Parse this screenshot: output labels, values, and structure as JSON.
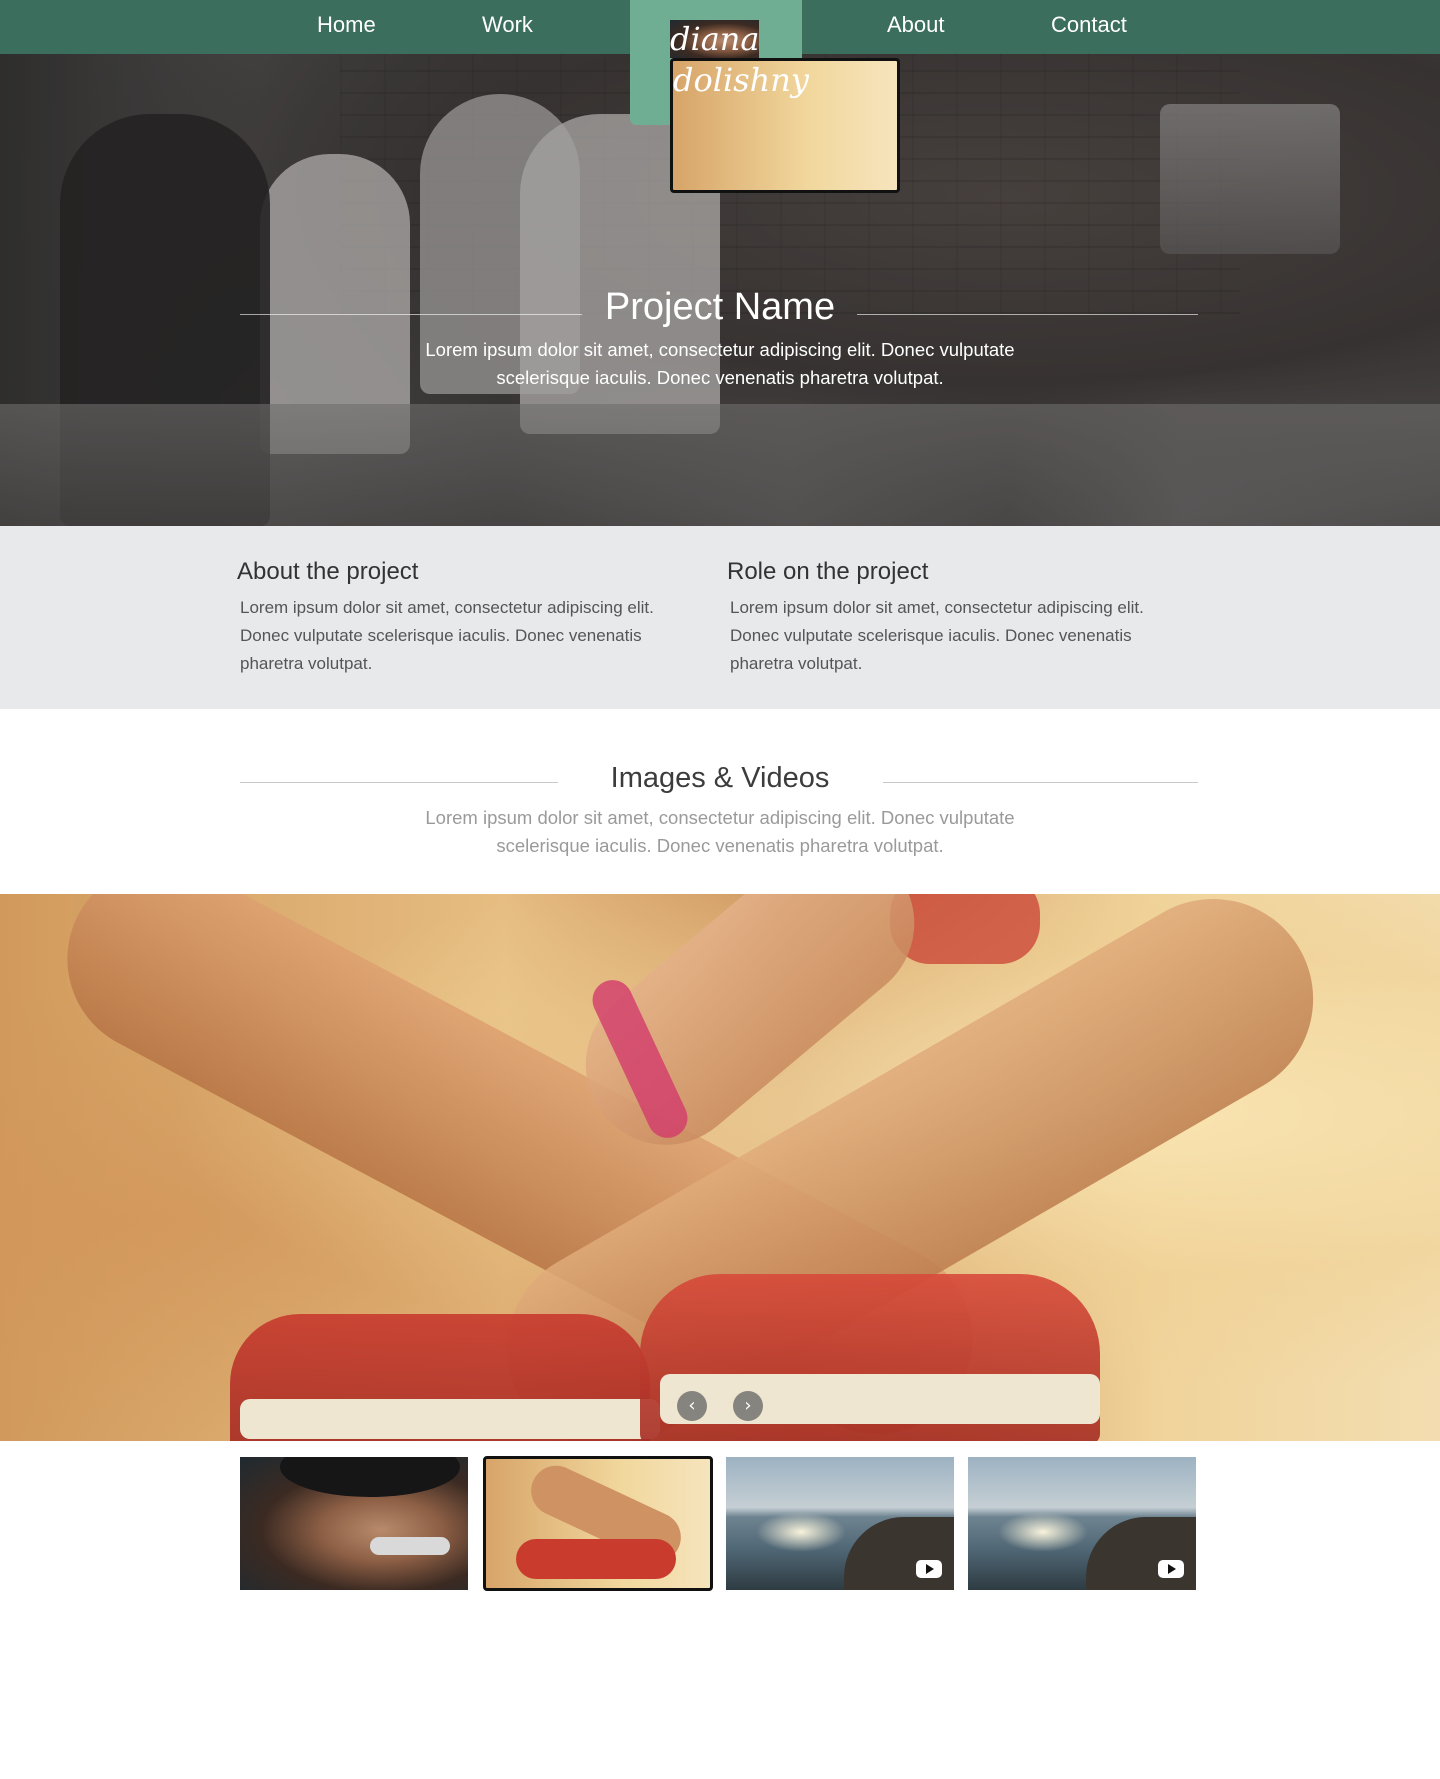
{
  "nav": {
    "items": [
      {
        "label": "Home"
      },
      {
        "label": "Work"
      },
      {
        "label": "About"
      },
      {
        "label": "Contact"
      }
    ],
    "logo": {
      "line1": "diana",
      "line2": "dolishny"
    },
    "bg_color": "#3b6e5c",
    "logo_color": "#6fae93"
  },
  "hero": {
    "title": "Project Name",
    "subtitle": "Lorem ipsum dolor sit amet, consectetur adipiscing elit. Donec vulputate scelerisque iaculis. Donec venenatis pharetra volutpat."
  },
  "about": {
    "project_title": "About the project",
    "project_text": "Lorem ipsum dolor sit amet, consectetur adipiscing elit. Donec vulputate scelerisque iaculis. Donec venenatis pharetra volutpat.",
    "role_title": "Role on the project",
    "role_text": "Lorem ipsum dolor sit amet, consectetur adipiscing elit. Donec vulputate scelerisque iaculis. Donec venenatis pharetra volutpat."
  },
  "media": {
    "title": "Images & Videos",
    "subtitle": "Lorem ipsum dolor sit amet, consectetur adipiscing elit. Donec vulputate scelerisque iaculis. Donec venenatis pharetra volutpat.",
    "prev_icon": "chevron-left-icon",
    "next_icon": "chevron-right-icon",
    "prev_glyph": "‹",
    "next_glyph": "›",
    "thumbnails": [
      {
        "kind": "image",
        "subject": "portrait"
      },
      {
        "kind": "image",
        "subject": "sneakers",
        "selected": true
      },
      {
        "kind": "video",
        "subject": "coastline"
      },
      {
        "kind": "video",
        "subject": "coastline"
      }
    ]
  }
}
